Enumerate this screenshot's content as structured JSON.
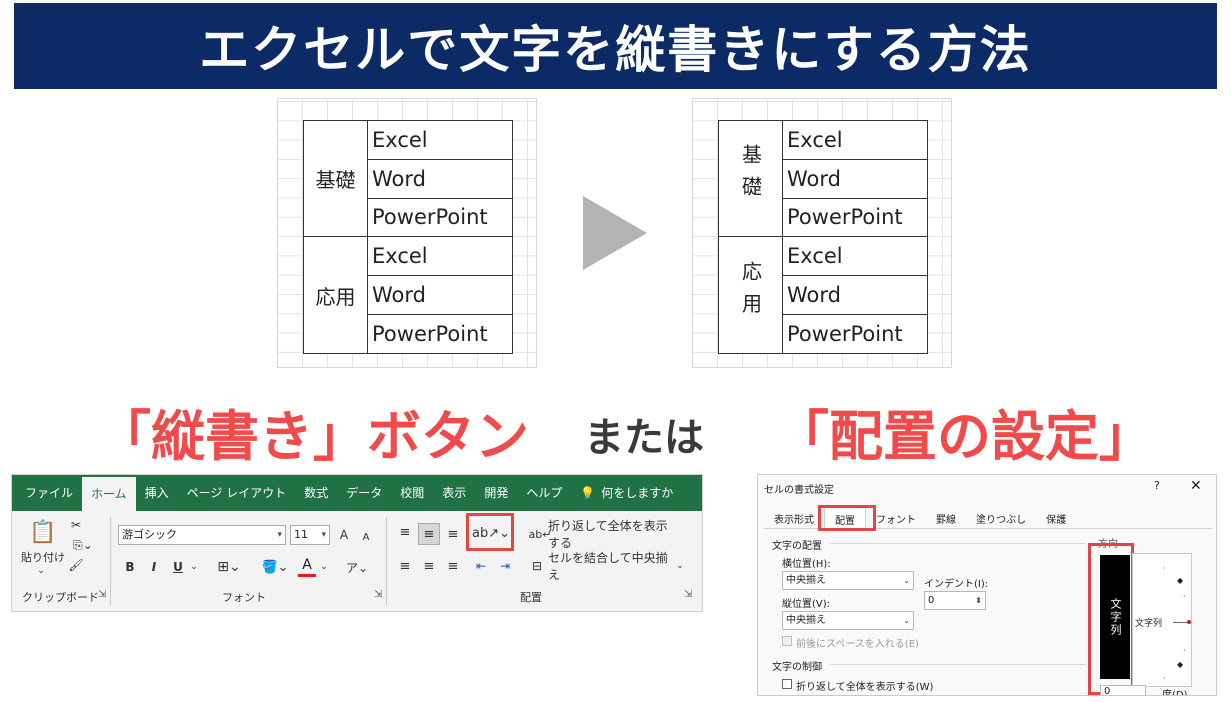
{
  "title": "エクセルで文字を縦書きにする方法",
  "example_before": {
    "groups": [
      {
        "category": "基礎",
        "items": [
          "Excel",
          "Word",
          "PowerPoint"
        ]
      },
      {
        "category": "応用",
        "items": [
          "Excel",
          "Word",
          "PowerPoint"
        ]
      }
    ]
  },
  "example_after": {
    "groups": [
      {
        "category": "基礎",
        "items": [
          "Excel",
          "Word",
          "PowerPoint"
        ]
      },
      {
        "category": "応用",
        "items": [
          "Excel",
          "Word",
          "PowerPoint"
        ]
      }
    ]
  },
  "labels": {
    "left": "「縦書き」ボタン",
    "middle": "または",
    "right": "「配置の設定」"
  },
  "ribbon": {
    "tabs": [
      "ファイル",
      "ホーム",
      "挿入",
      "ページ レイアウト",
      "数式",
      "データ",
      "校閲",
      "表示",
      "開発",
      "ヘルプ"
    ],
    "active_tab": "ホーム",
    "search": "何をしますか",
    "clipboard": {
      "paste_label": "貼り付け",
      "group_label": "クリップボード"
    },
    "font": {
      "font_name": "游ゴシック",
      "font_size": "11",
      "group_label": "フォント",
      "bold": "B",
      "italic": "I",
      "underline": "U",
      "grow": "A",
      "shrink": "A"
    },
    "alignment": {
      "wrap_label": "折り返して全体を表示する",
      "merge_label": "セルを結合して中央揃え",
      "group_label": "配置"
    }
  },
  "dialog": {
    "title": "セルの書式設定",
    "help": "?",
    "close": "✕",
    "tabs": [
      "表示形式",
      "配置",
      "フォント",
      "罫線",
      "塗りつぶし",
      "保護"
    ],
    "active_tab": "配置",
    "section_alignment": "文字の配置",
    "horizontal_label": "横位置(H):",
    "horizontal_value": "中央揃え",
    "indent_label": "インデント(I):",
    "indent_value": "0",
    "vertical_label": "縦位置(V):",
    "vertical_value": "中央揃え",
    "space_label": "前後にスペースを入れる(E)",
    "section_control": "文字の制御",
    "wrap_label": "折り返して全体を表示する(W)",
    "orientation_label": "方向",
    "vertical_text": "文字列",
    "horizontal_text": "文字列",
    "degree_value": "0",
    "degree_label": "度(D)"
  },
  "colors": {
    "banner": "#0b2a66",
    "label_red": "#f04a4a",
    "excel_green": "#207245",
    "highlight": "#e34444"
  }
}
